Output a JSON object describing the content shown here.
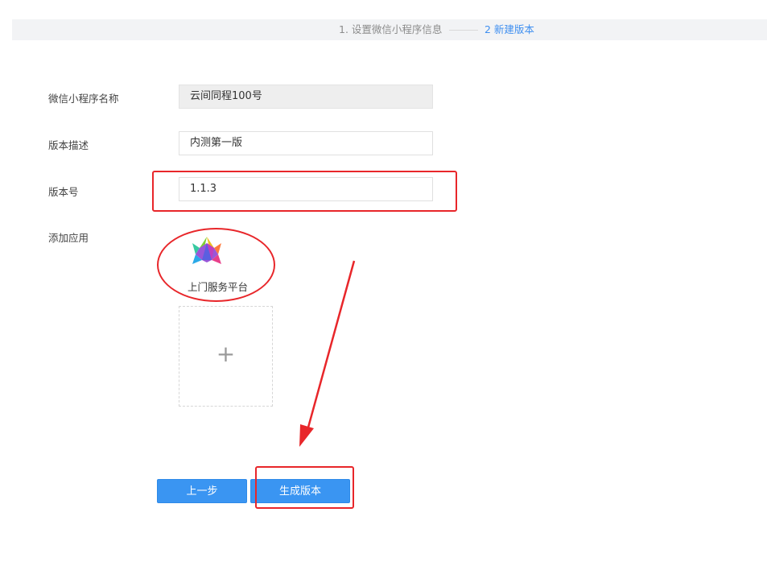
{
  "steps": {
    "step1_label": "1. 设置微信小程序信息",
    "step2_label": "2 新建版本"
  },
  "form": {
    "name_label": "微信小程序名称",
    "name_value": "云间同程100号",
    "desc_label": "版本描述",
    "desc_value": "内测第一版",
    "version_label": "版本号",
    "version_value": "1.1.3",
    "apps_label": "添加应用"
  },
  "apps": [
    {
      "name": "上门服务平台",
      "icon": "colorful-star-logo-icon"
    }
  ],
  "add_app": {
    "icon": "+"
  },
  "buttons": {
    "prev_label": "上一步",
    "generate_label": "生成版本"
  },
  "colors": {
    "accent": "#3a95f2",
    "active_step": "#3f8ff0",
    "annotation": "#e8262a"
  }
}
